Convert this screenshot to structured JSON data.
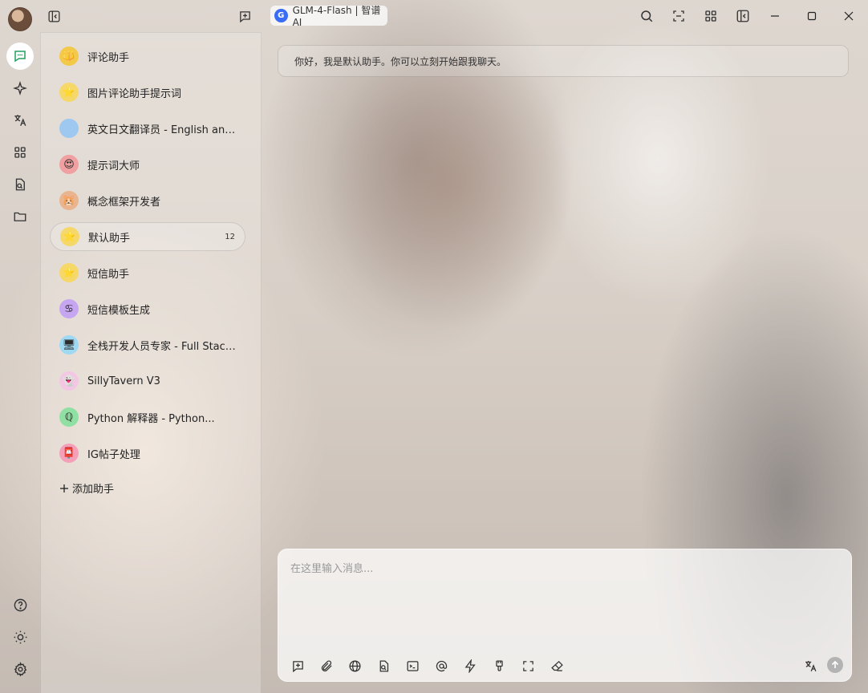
{
  "app": {
    "model_chip": {
      "label": "GLM-4-Flash | 智谱AI",
      "logo_letter": "G"
    }
  },
  "assistants": [
    {
      "emoji": "🔱",
      "bg": "#f3c94a",
      "label": "评论助手",
      "count": ""
    },
    {
      "emoji": "⭐",
      "bg": "#f6d76a",
      "label": "图片评论助手提示词",
      "count": ""
    },
    {
      "emoji": "",
      "bg": "#9ec8ef",
      "label": "英文日文翻译员 - English and...",
      "count": ""
    },
    {
      "emoji": "😍",
      "bg": "#f0a0a0",
      "label": "提示词大师",
      "count": ""
    },
    {
      "emoji": "🐹",
      "bg": "#e9b48e",
      "label": "概念框架开发者",
      "count": ""
    },
    {
      "emoji": "⭐",
      "bg": "#f6d76a",
      "label": "默认助手",
      "count": "12",
      "active": true
    },
    {
      "emoji": "⭐",
      "bg": "#f6d76a",
      "label": "短信助手",
      "count": ""
    },
    {
      "emoji": "♋",
      "bg": "#c6a6f0",
      "label": "短信模板生成",
      "count": ""
    },
    {
      "emoji": "🖥",
      "bg": "#9fd8f3",
      "label": "全栈开发人员专家 - Full Stack...",
      "count": ""
    },
    {
      "emoji": "👻",
      "bg": "#f3c7e4",
      "label": "SillyTavern V3",
      "count": ""
    },
    {
      "emoji": "ℚ",
      "bg": "#8fe0a2",
      "label": "Python 解释器 - Python...",
      "count": ""
    },
    {
      "emoji": "📮",
      "bg": "#f3a0b8",
      "label": "IG帖子处理",
      "count": ""
    }
  ],
  "add_assistant_label": "添加助手",
  "welcome_message": "你好，我是默认助手。你可以立刻开始跟我聊天。",
  "composer": {
    "placeholder": "在这里输入消息..."
  },
  "colors": {
    "accent_green": "#22a060",
    "send_disabled": "#b3b3b3"
  }
}
